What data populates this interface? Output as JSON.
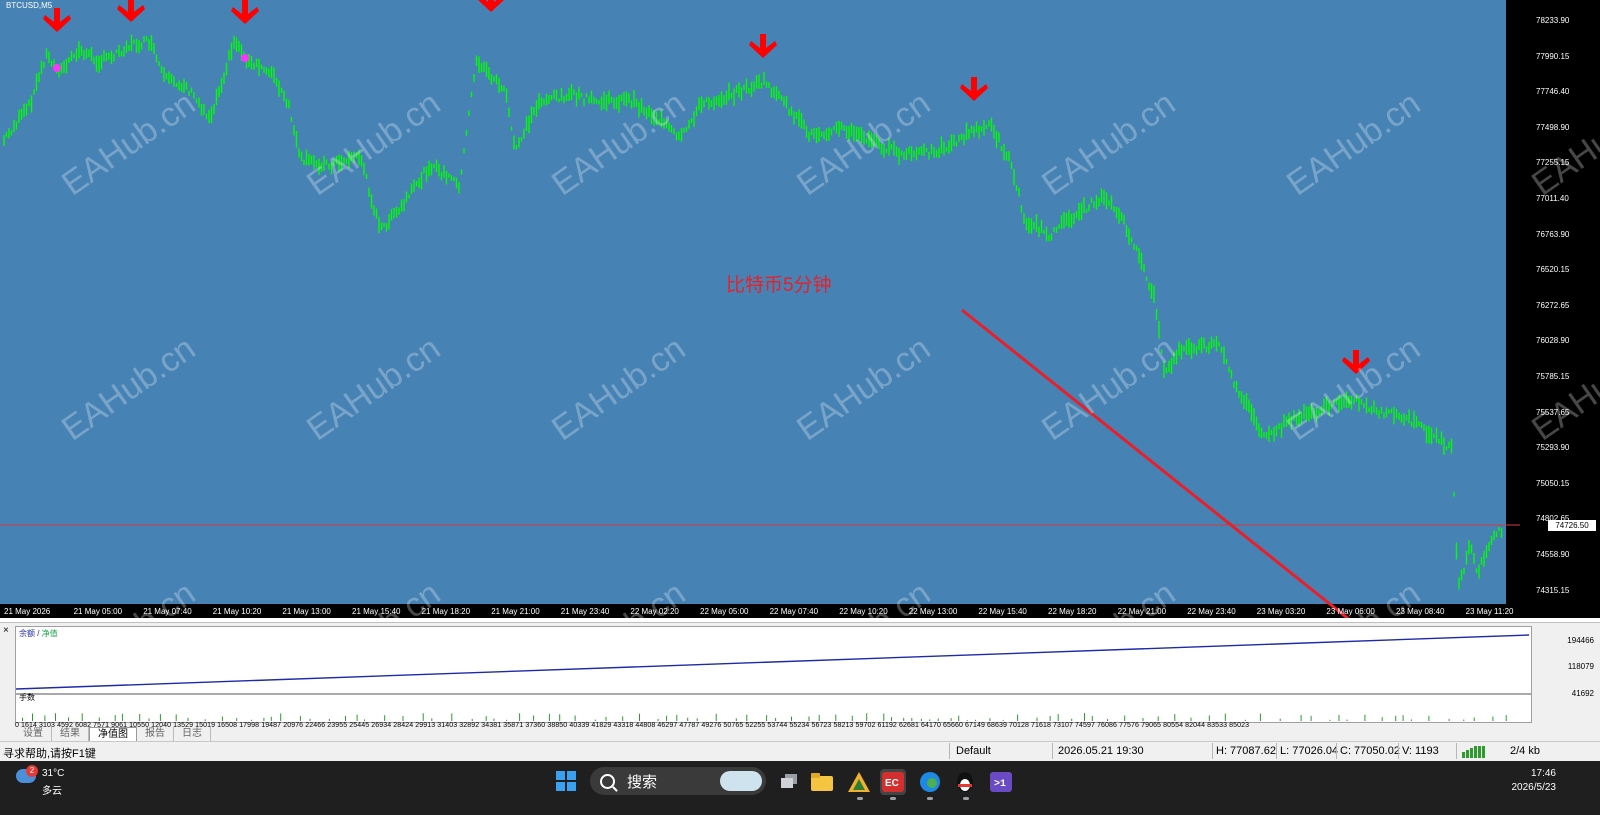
{
  "chart": {
    "symbol": "BTCUSD,M5",
    "background_color": "#4682b4",
    "candle_color": "#00ff00",
    "arrow_color": "#ff0000",
    "note": "比特币5分钟",
    "current_price": "74726.50",
    "price_axis": [
      "78233.90",
      "77990.15",
      "77746.40",
      "77498.90",
      "77255.15",
      "77011.40",
      "76763.90",
      "76520.15",
      "76272.65",
      "76028.90",
      "75785.15",
      "75537.65",
      "75293.90",
      "75050.15",
      "74802.65",
      "74558.90",
      "74315.15"
    ],
    "time_axis": [
      "21 May 2026",
      "21 May 05:00",
      "21 May 07:40",
      "21 May 10:20",
      "21 May 13:00",
      "21 May 15:40",
      "21 May 18:20",
      "21 May 21:00",
      "21 May 23:40",
      "22 May 02:20",
      "22 May 05:00",
      "22 May 07:40",
      "22 May 10:20",
      "22 May 13:00",
      "22 May 15:40",
      "22 May 18:20",
      "22 May 21:00",
      "22 May 23:40",
      "23 May 03:20",
      "23 May 06:00",
      "23 May 08:40",
      "23 May 11:20"
    ],
    "watermark": "EAHub.cn"
  },
  "tester": {
    "close_glyph": "×",
    "legend_balance": "余额",
    "legend_sep": " / ",
    "legend_equity": "净值",
    "lots_label": "手数",
    "axis": [
      "194466",
      "118079",
      "41692"
    ],
    "x_numbers": "0  1614  3103  4592  6082  7571  9061  10550 12040 13529 15019 16508 17998 19487 20976 22466 23955 25445 26934 28424 29913 31403 32892 34381 35871 37360 38850 40339 41829 43318 44808 46297 47787 49276 50765 52255 53744 55234 56723 58213 59702 61192 62681 64170 65660 67149 68639 70128 71618 73107 74597 76086 77576 79065 80554 82044 83533 85023",
    "tabs": [
      "设置",
      "结果",
      "净值图",
      "报告",
      "日志"
    ]
  },
  "status": {
    "help": "寻求帮助,请按F1键",
    "profile": "Default",
    "datetime": "2026.05.21 19:30",
    "high": "H: 77087.62",
    "low": "L: 77026.04",
    "close": "C: 77050.02",
    "volume": "V: 1193",
    "traffic": "2/4 kb"
  },
  "taskbar": {
    "weather_badge": "2",
    "temperature": "31°C",
    "condition": "多云",
    "search_label": "搜索",
    "time": "17:46",
    "date": "2026/5/23"
  }
}
